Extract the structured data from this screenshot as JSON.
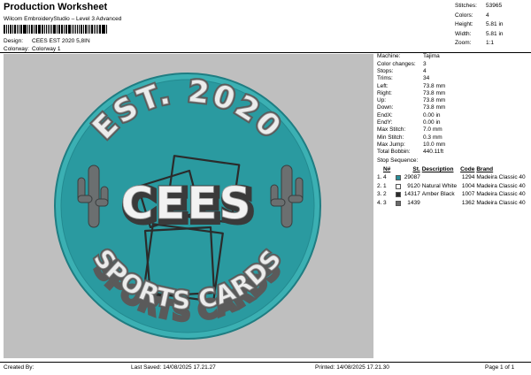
{
  "header": {
    "title": "Production Worksheet",
    "subtitle": "Wilcom EmbroideryStudio – Level 3 Advanced"
  },
  "design": {
    "label": "Design:",
    "value": "CEES EST 2020 5,8IN"
  },
  "colorway": {
    "label": "Colorway:",
    "value": "Colorway 1"
  },
  "stats": [
    {
      "label": "Stitches:",
      "value": "53965"
    },
    {
      "label": "Colors:",
      "value": "4"
    },
    {
      "label": "Height:",
      "value": "5.81 in"
    },
    {
      "label": "Width:",
      "value": "5.81 in"
    },
    {
      "label": "Zoom:",
      "value": "1:1"
    }
  ],
  "machine_info": [
    {
      "label": "Machine:",
      "value": "Tajima"
    },
    {
      "label": "Color changes:",
      "value": "3"
    },
    {
      "label": "Stops:",
      "value": "4"
    },
    {
      "label": "Trims:",
      "value": "34"
    },
    {
      "label": "Left:",
      "value": "73.8 mm"
    },
    {
      "label": "Right:",
      "value": "73.8 mm"
    },
    {
      "label": "Up:",
      "value": "73.8 mm"
    },
    {
      "label": "Down:",
      "value": "73.8 mm"
    },
    {
      "label": "EndX:",
      "value": "0.00 in"
    },
    {
      "label": "EndY:",
      "value": "0.00 in"
    },
    {
      "label": "Max Stitch:",
      "value": "7.0 mm"
    },
    {
      "label": "Min Stitch:",
      "value": "0.3 mm"
    },
    {
      "label": "Max Jump:",
      "value": "10.0 mm"
    },
    {
      "label": "Total Bobbin:",
      "value": "440.11ft"
    }
  ],
  "stop_sequence": {
    "title": "Stop Sequence:",
    "headers": {
      "idx": "",
      "n": "N#",
      "st": "St.",
      "desc": "Description",
      "code": "Code",
      "brand": "Brand"
    },
    "rows": [
      {
        "idx": "1.",
        "n": "4",
        "color": "#2a8f9a",
        "st": "29087",
        "desc": "",
        "code": "1294",
        "brand": "Madeira Classic 40"
      },
      {
        "idx": "2.",
        "n": "1",
        "color": "#ffffff",
        "st": "9120",
        "desc": "Natural White",
        "code": "1004",
        "brand": "Madeira Classic 40"
      },
      {
        "idx": "3.",
        "n": "2",
        "color": "#2b2b2b",
        "st": "14317",
        "desc": "Amber Black",
        "code": "1007",
        "brand": "Madeira Classic 40"
      },
      {
        "idx": "4.",
        "n": "3",
        "color": "#6a6a6a",
        "st": "1439",
        "desc": "",
        "code": "1362",
        "brand": "Madeira Classic 40"
      }
    ]
  },
  "patch": {
    "top_text": "EST. 2020",
    "center_text": "CEES",
    "bottom_text": "SPORTS CARDS",
    "teal": "#2a9aa0",
    "rim": "#3bb0b3",
    "white": "#ececec",
    "shadow": "#5a5a5a",
    "cactus": "#6b6f70"
  },
  "footer": {
    "created_by": "Created By:",
    "last_saved": "Last Saved: 14/08/2025 17.21.27",
    "printed": "Printed: 14/08/2025 17.21.30",
    "page": "Page 1 of 1"
  }
}
